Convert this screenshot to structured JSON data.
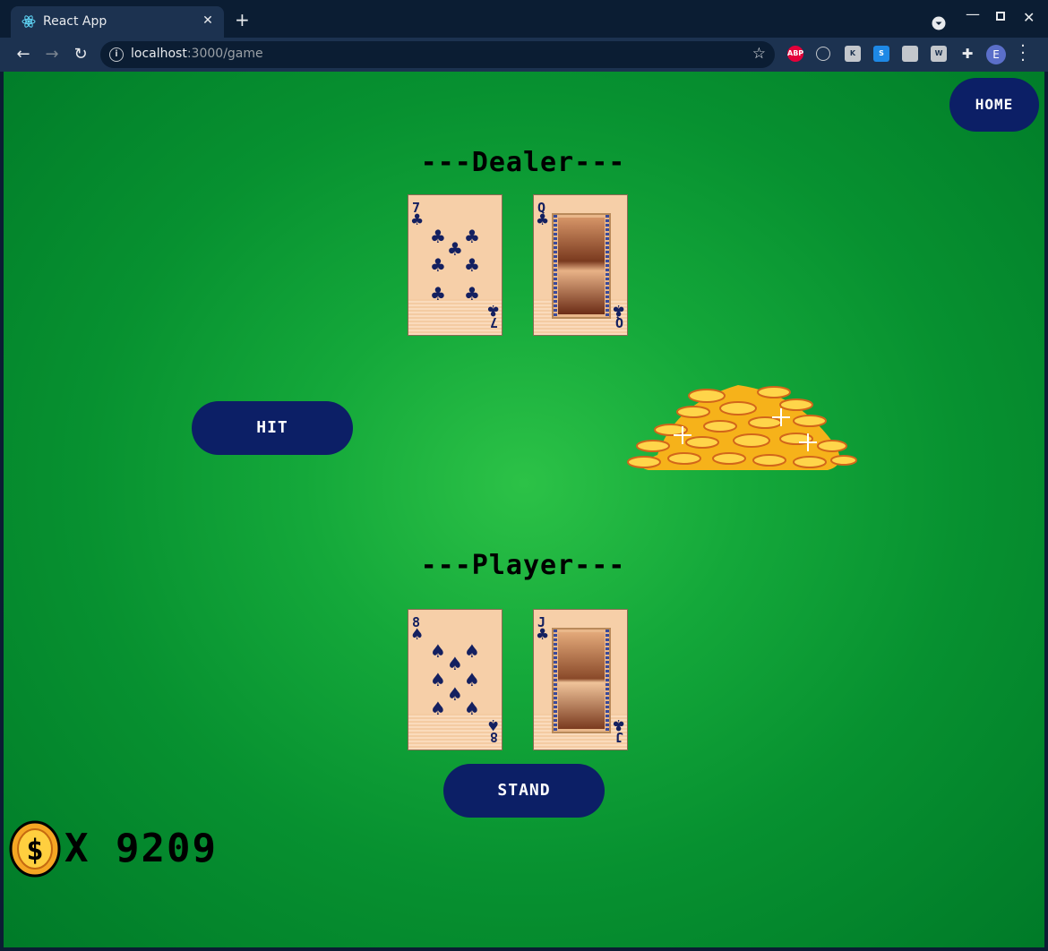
{
  "browser": {
    "tab_title": "React App",
    "url_host": "localhost",
    "url_path": ":3000/game",
    "extensions": [
      "ABP"
    ],
    "profile_initial": "E"
  },
  "game": {
    "home_label": "HOME",
    "dealer_title": "---Dealer---",
    "player_title": "---Player---",
    "hit_label": "HIT",
    "stand_label": "STAND",
    "balance_prefix": "X",
    "balance": "9209",
    "dealer_cards": [
      {
        "rank": "7",
        "suit": "clubs",
        "suit_symbol": "♣"
      },
      {
        "rank": "Q",
        "suit": "clubs",
        "suit_symbol": "♣"
      }
    ],
    "player_cards": [
      {
        "rank": "8",
        "suit": "spades",
        "suit_symbol": "♠"
      },
      {
        "rank": "J",
        "suit": "clubs",
        "suit_symbol": "♣"
      }
    ]
  },
  "colors": {
    "table_green": "#14a83a",
    "button_navy": "#0c1f66",
    "card_face": "#f6cfa8",
    "suit_ink": "#142060"
  }
}
